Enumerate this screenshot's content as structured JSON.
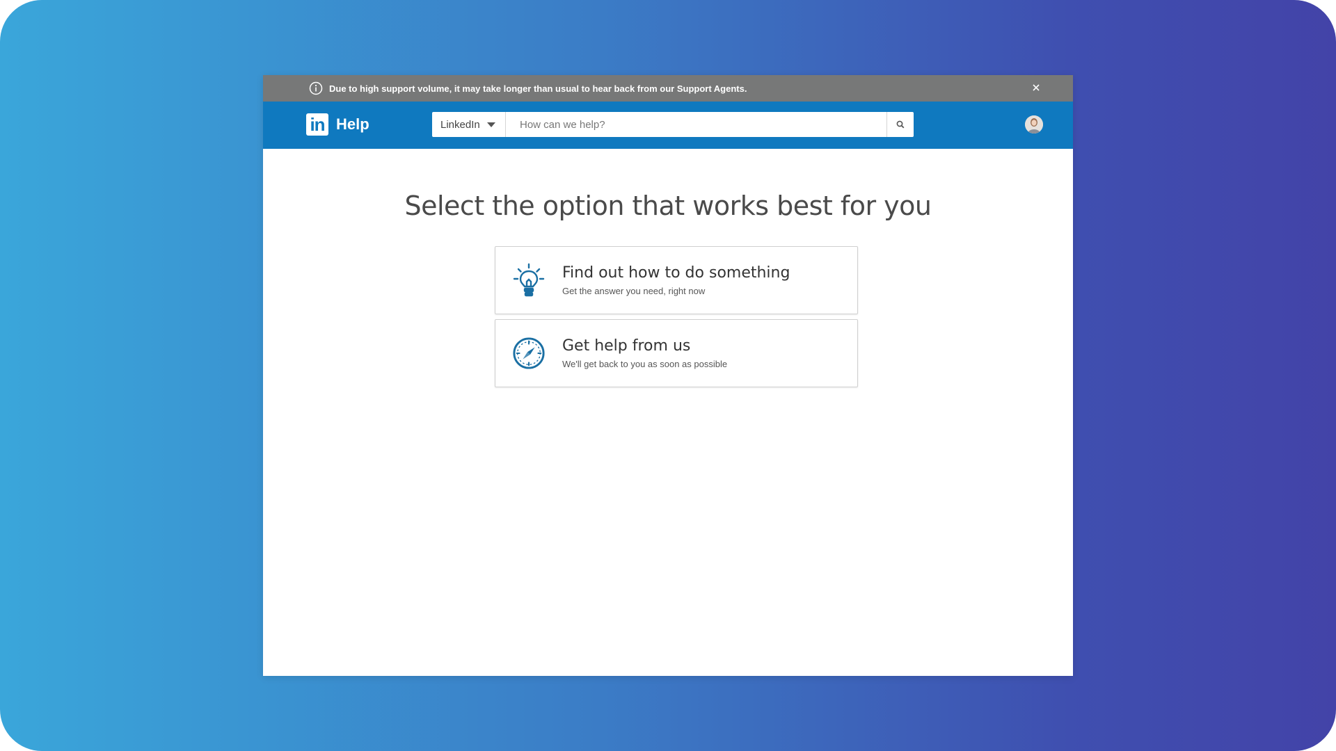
{
  "notice": {
    "text": "Due to high support volume, it may take longer than usual to hear back from our Support Agents."
  },
  "header": {
    "logo_text": "in",
    "brand_label": "Help",
    "product_selector": "LinkedIn",
    "search_placeholder": "How can we help?"
  },
  "main": {
    "title": "Select the option that works best for you",
    "options": [
      {
        "icon": "lightbulb-icon",
        "title": "Find out how to do something",
        "subtitle": "Get the answer you need, right now"
      },
      {
        "icon": "compass-icon",
        "title": "Get help from us",
        "subtitle": "We'll get back to you as soon as possible"
      }
    ]
  },
  "colors": {
    "brand_blue": "#0f79bf",
    "notice_gray": "#777878",
    "icon_blue": "#1a6fa3"
  }
}
